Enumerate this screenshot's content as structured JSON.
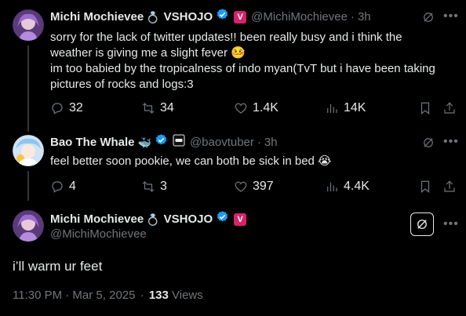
{
  "tweet1": {
    "name": "Michi Mochievee",
    "ring_emoji": "💍",
    "org": "VSHOJO",
    "handle": "@MichiMochievee",
    "dot": "·",
    "time": "3h",
    "lines": [
      "sorry for the lack of twitter updates!! been really busy and i think the",
      "weather is giving me a slight fever 🤒",
      "im too babied by the tropicalness of indo myan(TvT but i have been taking",
      "pictures of rocks and logs:3"
    ],
    "replies": "32",
    "retweets": "34",
    "likes": "1.4K",
    "views": "14K"
  },
  "tweet2": {
    "name": "Bao The Whale",
    "whale_emoji": "🐳",
    "handle": "@baovtuber",
    "dot": "·",
    "time": "3h",
    "text": "feel better soon pookie, we can both be sick in bed 😭",
    "replies": "4",
    "retweets": "3",
    "likes": "397",
    "views": "4.4K"
  },
  "tweet3": {
    "name": "Michi Mochievee",
    "ring_emoji": "💍",
    "org": "VSHOJO",
    "handle": "@MichiMochievee",
    "text": "i’ll warm ur feet",
    "timestamp": "11:30 PM · Mar 5, 2025",
    "dot": "·",
    "views_count": "133",
    "views_label": "Views"
  },
  "badge_letter": "V",
  "colors": {
    "verified": "#1d9bf0",
    "vshojo_badge": "#d6236b",
    "background": "#000000",
    "muted": "#71767b"
  }
}
